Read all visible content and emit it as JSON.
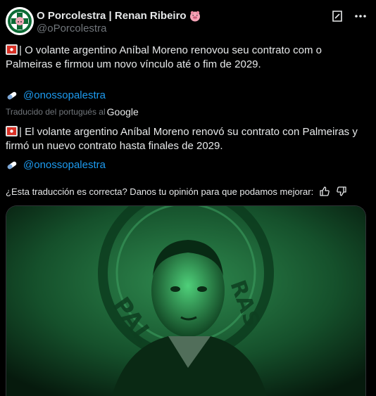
{
  "post": {
    "display_name": "O Porcolestra | Renan Ribeiro",
    "handle": "@oPorcolestra",
    "original_text": "| O volante argentino Aníbal Moreno renovou seu contrato com o Palmeiras e firmou um novo vínculo até o fim de 2029.",
    "original_link": "@onossopalestra",
    "translated_label": "Traducido del portugués al",
    "translated_provider": "Google",
    "translated_text": "| El volante argentino Aníbal Moreno renovó su contrato con Palmeiras y firmó un nuevo contrato hasta finales de 2029.",
    "translated_link": "@onossopalestra",
    "feedback_prompt": "¿Esta traducción es correcta? Danos tu opinión para que podamos mejorar:",
    "media_crest_text": "PALMEIRAS"
  },
  "icons": {
    "avatar": "palmeiras-pig-avatar",
    "name_emoji": "pig-face-icon",
    "grok": "grok-icon",
    "more": "more-dots-icon",
    "flag": "red-flag-emoji",
    "link_emoji": "pill-emoji",
    "thumbs_up": "thumbs-up-icon",
    "thumbs_down": "thumbs-down-icon"
  },
  "colors": {
    "background": "#000000",
    "text": "#e7e9ea",
    "muted": "#71767b",
    "link": "#1d9bf0",
    "media_green": "#1f6b3a"
  }
}
